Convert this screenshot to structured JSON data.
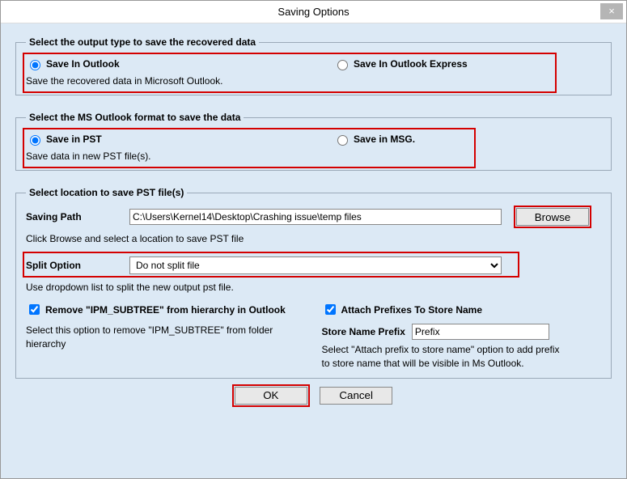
{
  "window": {
    "title": "Saving Options"
  },
  "group1": {
    "legend": "Select the output type to save the recovered data",
    "opt1": "Save In Outlook",
    "opt2": "Save In Outlook Express",
    "desc": "Save the recovered data in Microsoft Outlook."
  },
  "group2": {
    "legend": "Select the MS Outlook format to save the data",
    "opt1": "Save in PST",
    "opt2": "Save in MSG.",
    "desc": "Save data in new PST file(s)."
  },
  "group3": {
    "legend": "Select location to save PST file(s)",
    "saving_path_label": "Saving Path",
    "saving_path_value": "C:\\Users\\Kernel14\\Desktop\\Crashing issue\\temp files",
    "browse": "Browse",
    "browse_hint": "Click Browse and select a location to save PST file",
    "split_label": "Split Option",
    "split_value": "Do not split file",
    "split_hint": "Use dropdown list to split the new output pst file.",
    "remove_ipm_label": "Remove \"IPM_SUBTREE\" from hierarchy in Outlook",
    "remove_ipm_hint": "Select this option to remove \"IPM_SUBTREE\" from folder hierarchy",
    "attach_prefix_label": "Attach Prefixes To Store Name",
    "store_prefix_label": "Store Name Prefix",
    "store_prefix_value": "Prefix",
    "attach_prefix_hint": "Select \"Attach prefix to store name\" option to add prefix to store name that will be visible in Ms Outlook."
  },
  "buttons": {
    "ok": "OK",
    "cancel": "Cancel"
  }
}
